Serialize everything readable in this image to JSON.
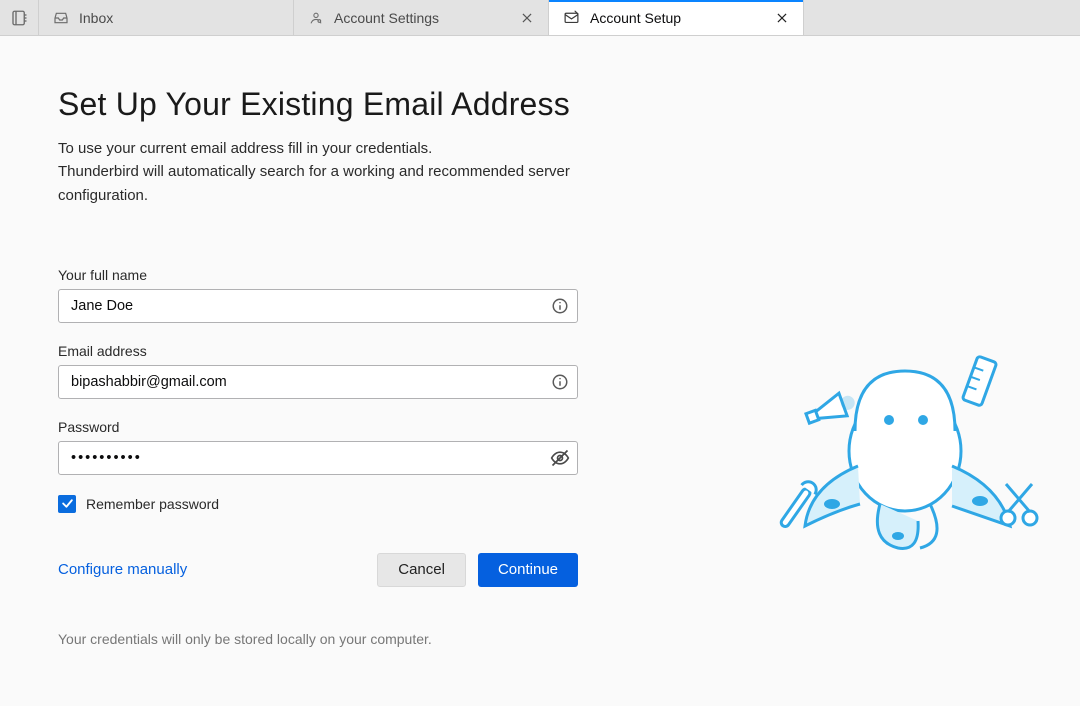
{
  "tabs": {
    "inbox": "Inbox",
    "account_settings": "Account Settings",
    "account_setup": "Account Setup"
  },
  "heading": "Set Up Your Existing Email Address",
  "subtitle_line1": "To use your current email address fill in your credentials.",
  "subtitle_line2": "Thunderbird will automatically search for a working and recommended server configuration.",
  "form": {
    "name_label": "Your full name",
    "name_value": "Jane Doe",
    "email_label": "Email address",
    "email_value": "bipashabbir@gmail.com",
    "password_label": "Password",
    "password_display": "••••••••••",
    "remember_label": "Remember password",
    "remember_checked": true
  },
  "actions": {
    "configure_manually": "Configure manually",
    "cancel": "Cancel",
    "continue": "Continue"
  },
  "footnote": "Your credentials will only be stored locally on your computer.",
  "colors": {
    "accent": "#0a84ff",
    "primary_button": "#0560df",
    "checkbox": "#0a6cde"
  }
}
